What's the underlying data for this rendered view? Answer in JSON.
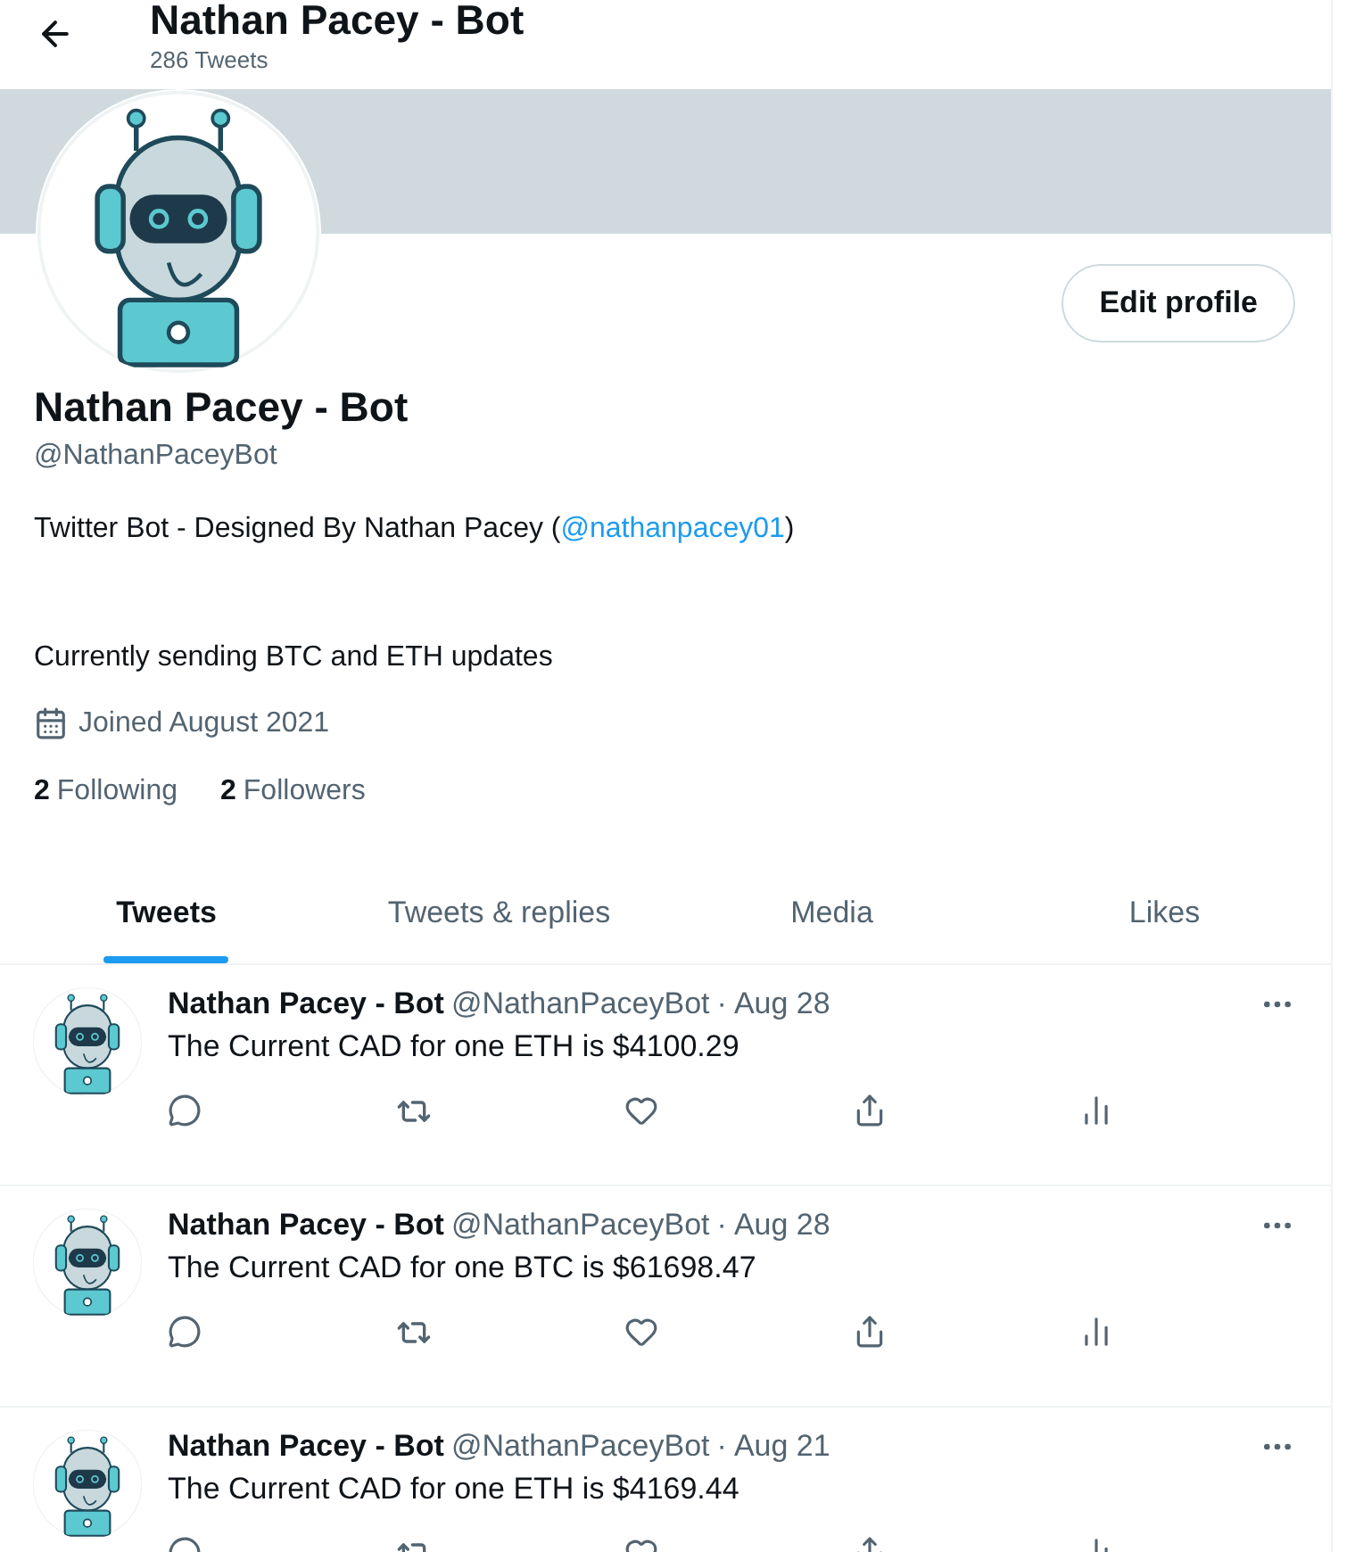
{
  "header": {
    "title": "Nathan Pacey - Bot",
    "subtitle": "286 Tweets"
  },
  "profile": {
    "edit_button": "Edit profile",
    "name": "Nathan Pacey - Bot",
    "handle": "@NathanPaceyBot",
    "bio": {
      "before": "Twitter Bot - Designed By Nathan Pacey (",
      "link": "@nathanpacey01",
      "after": ")"
    },
    "bio_line_2": "Currently sending BTC and ETH updates",
    "joined": "Joined August 2021",
    "following": {
      "count": "2",
      "label": "Following"
    },
    "followers": {
      "count": "2",
      "label": "Followers"
    }
  },
  "tabs": [
    {
      "label": "Tweets",
      "selected": true
    },
    {
      "label": "Tweets & replies",
      "selected": false
    },
    {
      "label": "Media",
      "selected": false
    },
    {
      "label": "Likes",
      "selected": false
    }
  ],
  "tweets": [
    {
      "name": "Nathan Pacey - Bot",
      "handle": "@NathanPaceyBot",
      "separator": "·",
      "date": "Aug 28",
      "text": "The Current CAD for one ETH is $4100.29"
    },
    {
      "name": "Nathan Pacey - Bot",
      "handle": "@NathanPaceyBot",
      "separator": "·",
      "date": "Aug 28",
      "text": "The Current CAD for one BTC is $61698.47"
    },
    {
      "name": "Nathan Pacey - Bot",
      "handle": "@NathanPaceyBot",
      "separator": "·",
      "date": "Aug 21",
      "text": "The Current CAD for one ETH is $4169.44"
    }
  ]
}
